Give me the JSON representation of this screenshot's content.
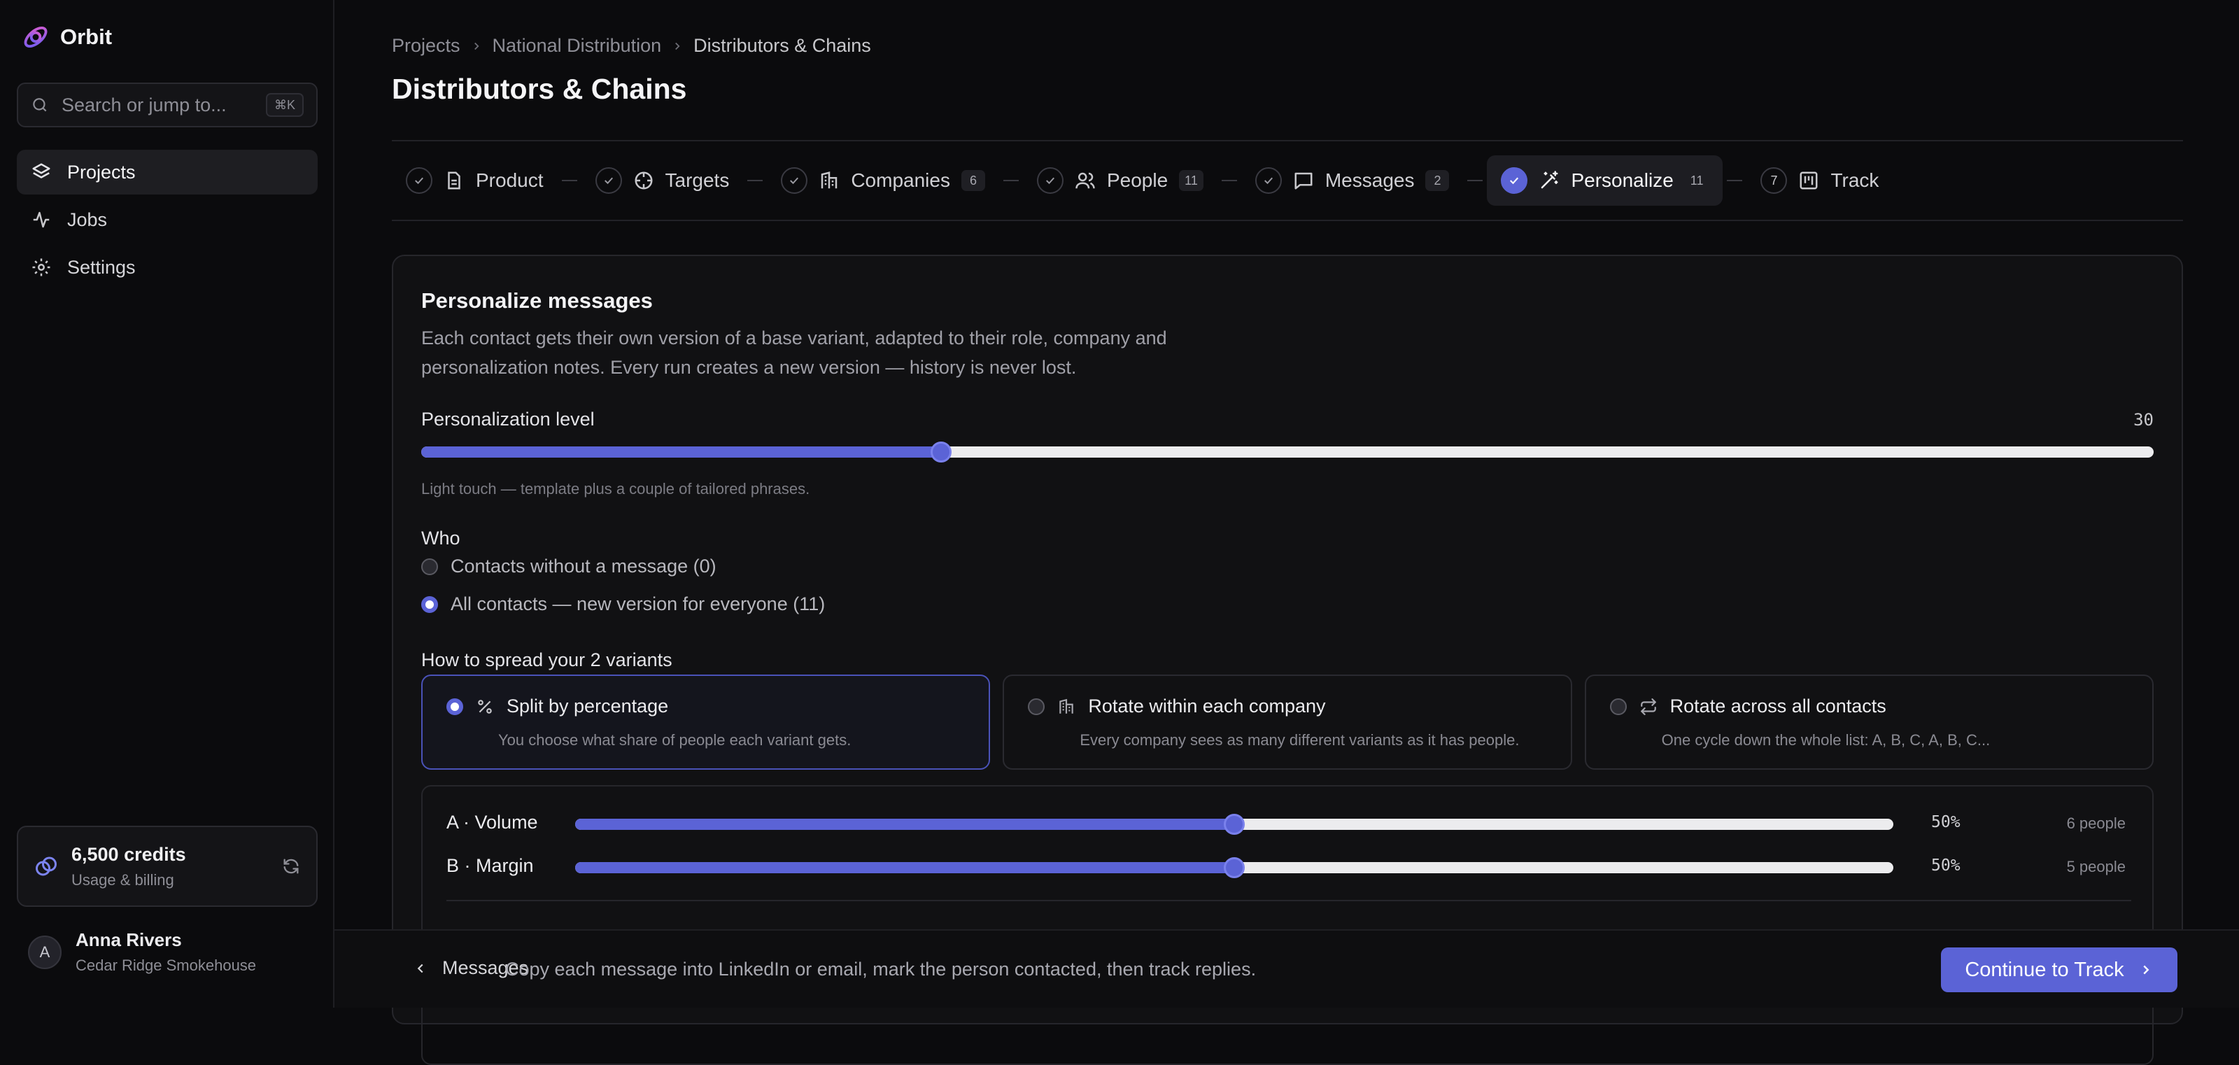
{
  "app": {
    "name": "Orbit"
  },
  "search": {
    "placeholder": "Search or jump to...",
    "shortcut": "⌘K"
  },
  "sidebar": {
    "items": [
      {
        "label": "Projects",
        "icon": "layers-icon",
        "active": true
      },
      {
        "label": "Jobs",
        "icon": "activity-icon"
      },
      {
        "label": "Settings",
        "icon": "gear-icon"
      }
    ],
    "credits": {
      "amount": "6,500 credits",
      "sub": "Usage & billing"
    },
    "user": {
      "initial": "A",
      "name": "Anna Rivers",
      "org": "Cedar Ridge Smokehouse"
    }
  },
  "breadcrumb": [
    "Projects",
    "National Distribution",
    "Distributors & Chains"
  ],
  "page_title": "Distributors & Chains",
  "steps": [
    {
      "label": "Product",
      "badge": "",
      "status": "done",
      "icon": "document-icon"
    },
    {
      "label": "Targets",
      "badge": "",
      "status": "done",
      "icon": "target-icon"
    },
    {
      "label": "Companies",
      "badge": "6",
      "status": "done",
      "icon": "building-icon"
    },
    {
      "label": "People",
      "badge": "11",
      "status": "done",
      "icon": "people-icon"
    },
    {
      "label": "Messages",
      "badge": "2",
      "status": "done",
      "icon": "message-icon"
    },
    {
      "label": "Personalize",
      "badge": "11",
      "status": "active",
      "icon": "wand-icon"
    },
    {
      "label": "Track",
      "badge": "",
      "status": "todo",
      "number": "7",
      "icon": "kanban-icon"
    }
  ],
  "personalize": {
    "title": "Personalize messages",
    "description": "Each contact gets their own version of a base variant, adapted to their role, company and personalization notes. Every run creates a new version — history is never lost.",
    "level_label": "Personalization level",
    "level_value": "30",
    "level_fraction": 0.3,
    "level_hint": "Light touch — template plus a couple of tailored phrases.",
    "who_label": "Who",
    "who_options": [
      {
        "label": "Contacts without a message (0)",
        "selected": false
      },
      {
        "label": "All contacts — new version for everyone (11)",
        "selected": true
      }
    ],
    "spread_label": "How to spread your 2 variants",
    "spread_options": [
      {
        "title": "Split by percentage",
        "sub": "You choose what share of people each variant gets.",
        "icon": "percent-icon",
        "selected": true
      },
      {
        "title": "Rotate within each company",
        "sub": "Every company sees as many different variants as it has people.",
        "icon": "building-icon",
        "selected": false
      },
      {
        "title": "Rotate across all contacts",
        "sub": "One cycle down the whole list: A, B, C, A, B, C...",
        "icon": "repeat-icon",
        "selected": false
      }
    ],
    "variants": [
      {
        "name": "A · Volume",
        "percent": "50%",
        "fraction": 0.5,
        "people": "6 people"
      },
      {
        "name": "B · Margin",
        "percent": "50%",
        "fraction": 0.5,
        "people": "5 people"
      }
    ]
  },
  "bottom_bar": {
    "back_label": "Messages",
    "message": "Copy each message into LinkedIn or email, mark the person contacted, then track replies.",
    "continue_label": "Continue to Track"
  },
  "colors": {
    "accent": "#5b63d6",
    "background": "#0b0b0d",
    "card": "#111113"
  }
}
